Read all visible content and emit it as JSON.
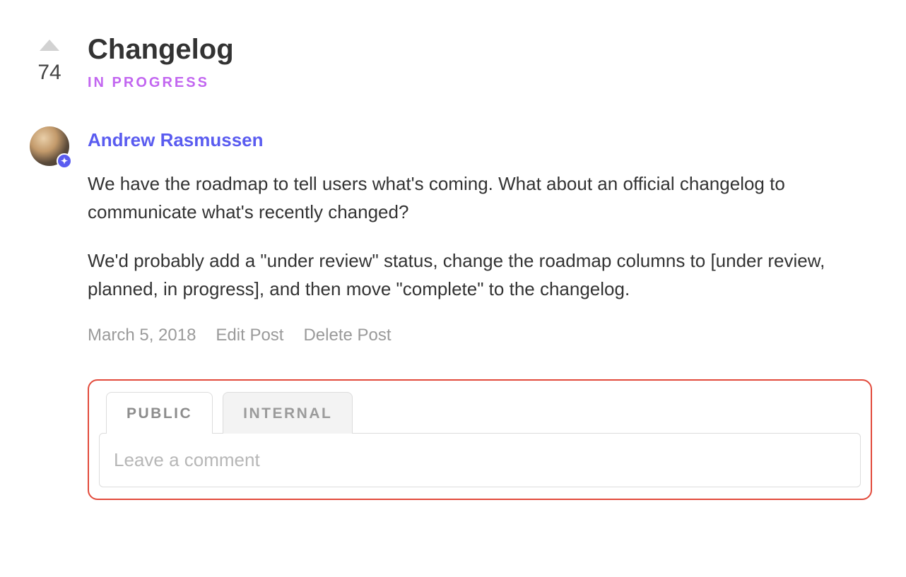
{
  "post": {
    "title": "Changelog",
    "status": "IN PROGRESS",
    "votes": 74
  },
  "comment": {
    "author": "Andrew Rasmussen",
    "paragraph1": "We have the roadmap to tell users what's coming. What about an official changelog to communicate what's recently changed?",
    "paragraph2": "We'd probably add a \"under review\" status, change the roadmap columns to [under review, planned, in progress], and then move \"complete\" to the changelog.",
    "date": "March 5, 2018",
    "edit_label": "Edit Post",
    "delete_label": "Delete Post",
    "badge_glyph": "✦"
  },
  "reply": {
    "tabs": {
      "public": "PUBLIC",
      "internal": "INTERNAL"
    },
    "placeholder": "Leave a comment"
  }
}
